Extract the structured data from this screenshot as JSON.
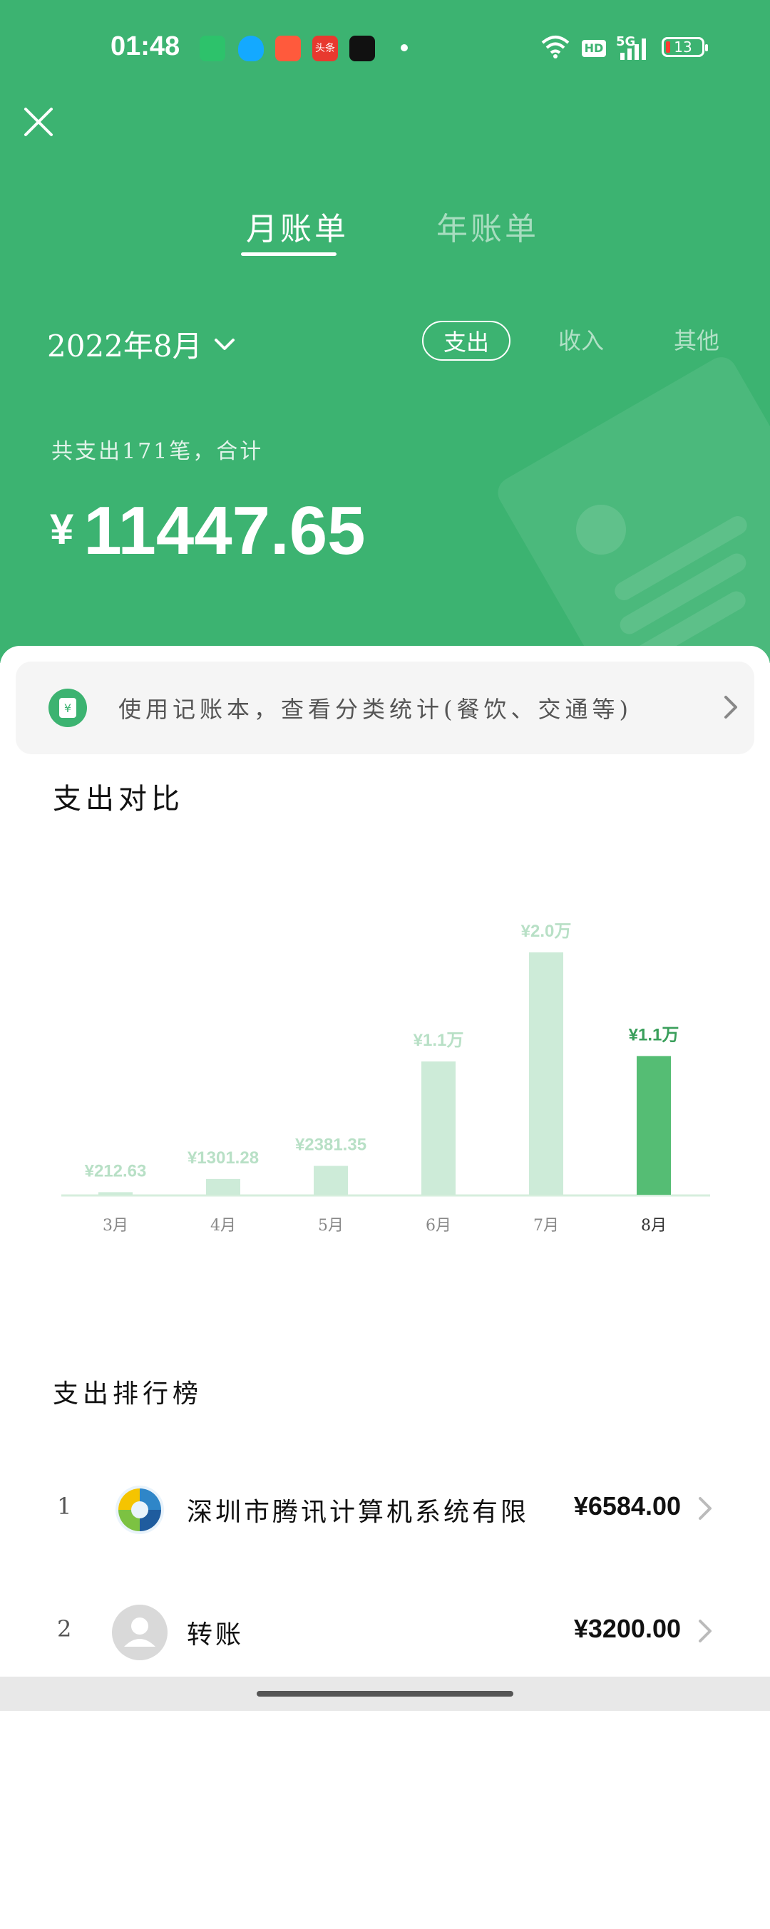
{
  "status_bar": {
    "time": "01:48",
    "app_icons": [
      {
        "name": "battery-saver-app-icon",
        "color": "#2dc26b"
      },
      {
        "name": "qq-icon",
        "color": "#14a9ff"
      },
      {
        "name": "kuaishou-icon",
        "color": "#ff5a3c"
      },
      {
        "name": "toutiao-icon",
        "color": "#e8392f",
        "label": "头条"
      },
      {
        "name": "douyin-icon",
        "color": "#111111"
      }
    ],
    "hd_label": "HD",
    "network_label": "5G",
    "battery_level": "13"
  },
  "header": {
    "tabs": [
      {
        "label": "月账单",
        "active": true
      },
      {
        "label": "年账单",
        "active": false
      }
    ],
    "month_selector": "2022年8月",
    "filters": [
      {
        "label": "支出",
        "active": true
      },
      {
        "label": "收入",
        "active": false
      },
      {
        "label": "其他",
        "active": false
      }
    ],
    "summary_text": "共支出171笔，合计",
    "currency": "¥",
    "total_amount": "11447.65"
  },
  "notice": {
    "text": "使用记账本，查看分类统计(餐饮、交通等)"
  },
  "comparison": {
    "title": "支出对比"
  },
  "chart_data": {
    "type": "bar",
    "categories": [
      "3月",
      "4月",
      "5月",
      "6月",
      "7月",
      "8月"
    ],
    "values": [
      212.63,
      1301.28,
      2381.35,
      11000,
      20000,
      11447.65
    ],
    "data_labels": [
      "¥212.63",
      "¥1301.28",
      "¥2381.35",
      "¥1.1万",
      "¥2.0万",
      "¥1.1万"
    ],
    "highlight_index": 5,
    "colors": {
      "bar": "#cdebd8",
      "highlight": "#55bd74",
      "label": "#b8e0c6",
      "highlight_label": "#3a9f5b",
      "axis": "#d6eedd"
    },
    "title": "",
    "xlabel": "",
    "ylabel": ""
  },
  "ranking": {
    "title": "支出排行榜",
    "items": [
      {
        "rank": "1",
        "name": "深圳市腾讯计算机系统有限...",
        "amount": "¥6584.00",
        "avatar": "tencent-logo"
      },
      {
        "rank": "2",
        "name": "转账",
        "amount": "¥3200.00",
        "avatar": "default-user-avatar"
      }
    ]
  },
  "colors": {
    "brand_green": "#3cb371"
  }
}
